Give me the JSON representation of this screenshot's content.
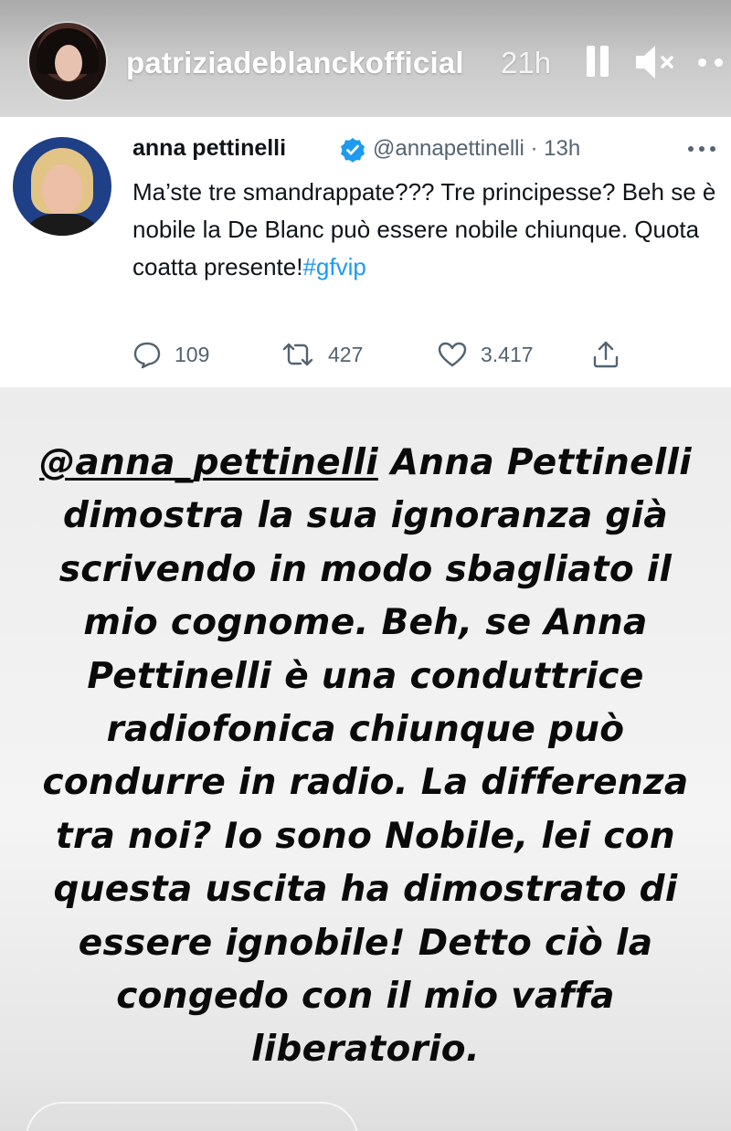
{
  "story": {
    "username": "patriziadeblanckofficial",
    "time": "21h",
    "controls": {
      "pause_icon": "pause-icon",
      "mute_icon": "speaker-muted-icon",
      "more_icon": "more-horizontal-icon"
    }
  },
  "tweet": {
    "author_name": "anna pettinelli",
    "handle_time": "@annapettinelli · 13h",
    "text": "Ma’ste tre smandrappate??? Tre principesse? Beh se è nobile la De Blanc può essere nobile chiunque. Quota coatta presente!",
    "hashtag": "#gfvip",
    "replies": "109",
    "retweets": "427",
    "likes": "3.417",
    "colors": {
      "verified": "#1d9bf0",
      "hashtag": "#1d9bf0",
      "meta": "#536471"
    }
  },
  "caption": {
    "mention": "@anna_pettinelli",
    "text": " Anna Pettinelli dimostra la sua ignoranza già scrivendo in modo sbagliato il mio cognome. Beh, se Anna Pettinelli è una conduttrice radiofonica chiunque può condurre in radio.  La differenza tra noi? Io sono Nobile, lei con questa uscita ha dimostrato di essere ignobile! Detto ciò la congedo con il mio vaffa liberatorio."
  }
}
